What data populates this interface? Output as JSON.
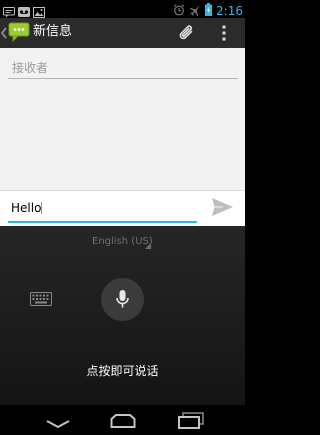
{
  "status_bar": {
    "time": "2:16",
    "left_icons": [
      "message-icon",
      "voicemail-icon",
      "image-icon"
    ],
    "right_icons": [
      "alarm-icon",
      "airplane-mode-icon",
      "battery-icon"
    ]
  },
  "action_bar": {
    "title": "新信息",
    "icons": [
      "up-arrow-icon",
      "messaging-app-icon",
      "attach-icon",
      "overflow-menu-icon"
    ]
  },
  "recipient": {
    "placeholder": "接收者"
  },
  "compose": {
    "message_text": "Hello",
    "send_icon": "send-icon"
  },
  "voice_input": {
    "language": "English (US)",
    "hint": "点按即可说话",
    "icons": [
      "keyboard-icon",
      "microphone-icon"
    ]
  },
  "nav_bar": {
    "icons": [
      "back-icon",
      "home-icon",
      "recent-apps-icon"
    ]
  },
  "colors": {
    "accent": "#33b5e5",
    "action_bar": "#2b2b2b",
    "recipient_bg": "#f2f2f2",
    "voice_bg": "#1c1c1c"
  }
}
